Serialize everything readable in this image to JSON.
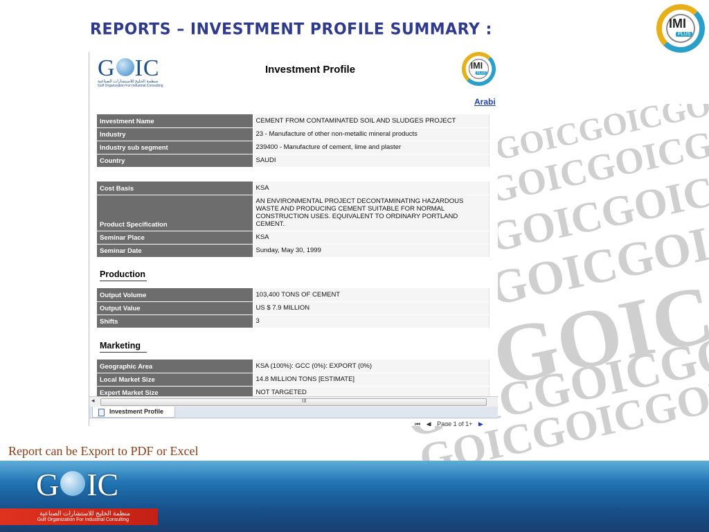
{
  "slide": {
    "title": "REPORTS – INVESTMENT PROFILE SUMMARY :",
    "caption": "Report can be Export to PDF or Excel"
  },
  "logos": {
    "imi_text": "IMI",
    "imi_plus": "PLUS",
    "goic_word_left": "G",
    "goic_word_right": "IC",
    "goic_globe_text": "GOIC",
    "goic_arabic": "منظمة الخليج للاستشارات الصناعية",
    "goic_english": "Gulf Organization For Industrial Consulting"
  },
  "watermark": {
    "text": "GOICGOICGOICGOIC"
  },
  "report": {
    "title": "Investment Profile",
    "language_link": "Arabi",
    "general": [
      {
        "label": "Investment Name",
        "value": "CEMENT FROM CONTAMINATED SOIL AND SLUDGES PROJECT"
      },
      {
        "label": "Industry",
        "value": "23  -  Manufacture of other non-metallic mineral products"
      },
      {
        "label": "Industry sub segment",
        "value": "239400  -  Manufacture of cement, lime and plaster"
      },
      {
        "label": "Country",
        "value": "SAUDI"
      }
    ],
    "details": [
      {
        "label": "Cost Basis",
        "value": "KSA"
      },
      {
        "label": "Product Specification",
        "value": "AN ENVIRONMENTAL PROJECT DECONTAMINATING HAZARDOUS WASTE AND PRODUCING CEMENT SUITABLE FOR NORMAL CONSTRUCTION USES.  EQUIVALENT TO ORDINARY PORTLAND CEMENT."
      },
      {
        "label": "Seminar Place",
        "value": "KSA"
      },
      {
        "label": "Seminar Date",
        "value": "Sunday, May 30, 1999"
      }
    ],
    "production_heading": "Production",
    "production": [
      {
        "label": "Output Volume",
        "value": "103,400 TONS OF CEMENT"
      },
      {
        "label": "Output Value",
        "value": "US $ 7.9 MILLION"
      },
      {
        "label": "Shifts",
        "value": "3"
      }
    ],
    "marketing_heading": "Marketing",
    "marketing": [
      {
        "label": "Geographic Area",
        "value": "KSA (100%):    GCC (0%):    EXPORT (0%)"
      },
      {
        "label": "Local Market Size",
        "value": "14.8 MILLION TONS [ESTIMATE]"
      },
      {
        "label": "Expert Market Size",
        "value": "NOT TARGETED"
      }
    ]
  },
  "viewer": {
    "tab_label": "Investment Profile",
    "scroll_grip": "III",
    "pager_first": "⏮",
    "pager_prev": "◀",
    "pager_text": "Page 1 of 1+",
    "pager_next": "▶"
  },
  "colors": {
    "title_blue": "#2e3a8c",
    "label_gray": "#6d6d6d",
    "caption_brown": "#8a3a12",
    "footer_blue": "#1f6fae"
  }
}
